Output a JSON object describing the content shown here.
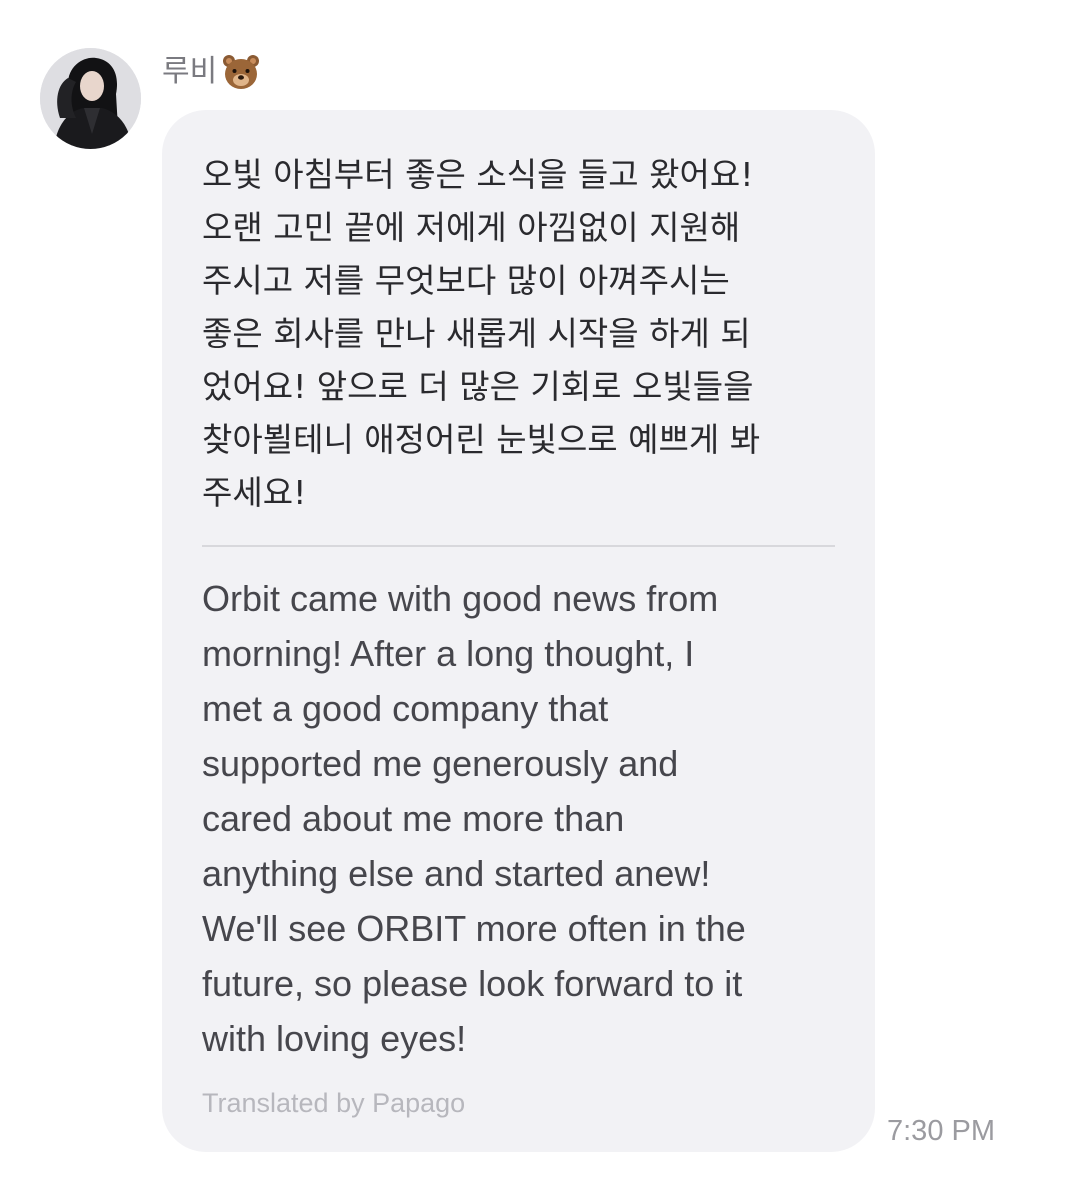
{
  "sender": {
    "name": "루비",
    "emoji_icon": "bear-face-icon"
  },
  "message": {
    "original_text": "오빛 아침부터 좋은 소식을 들고 왔어요!\n오랜 고민 끝에 저에게 아낌없이 지원해\n주시고 저를 무엇보다 많이 아껴주시는\n좋은 회사를 만나 새롭게 시작을 하게 되\n었어요! 앞으로 더 많은 기회로 오빛들을\n찾아뵐테니 애정어린 눈빛으로 예쁘게 봐\n주세요!",
    "translated_text": "Orbit came with good news from\nmorning! After a long thought, I\nmet a good company that\nsupported me generously and\ncared about me more than\nanything else and started anew!\nWe'll see ORBIT more often in the\nfuture, so please look forward to it\nwith loving eyes!",
    "translator_label": "Translated by Papago",
    "timestamp": "7:30 PM"
  },
  "colors": {
    "bubble_background": "#f2f2f5",
    "text_primary": "#2a2a2e",
    "text_secondary": "#7a7a80",
    "translator_label": "#b7b7bd"
  }
}
